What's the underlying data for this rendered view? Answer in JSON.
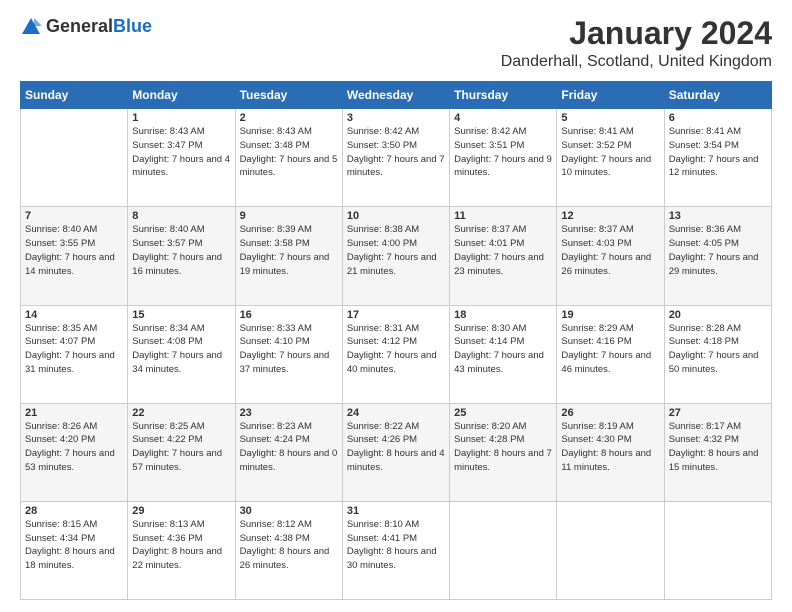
{
  "logo": {
    "general": "General",
    "blue": "Blue"
  },
  "header": {
    "month": "January 2024",
    "location": "Danderhall, Scotland, United Kingdom"
  },
  "days_of_week": [
    "Sunday",
    "Monday",
    "Tuesday",
    "Wednesday",
    "Thursday",
    "Friday",
    "Saturday"
  ],
  "weeks": [
    [
      {
        "day": "",
        "sunrise": "",
        "sunset": "",
        "daylight": ""
      },
      {
        "day": "1",
        "sunrise": "Sunrise: 8:43 AM",
        "sunset": "Sunset: 3:47 PM",
        "daylight": "Daylight: 7 hours and 4 minutes."
      },
      {
        "day": "2",
        "sunrise": "Sunrise: 8:43 AM",
        "sunset": "Sunset: 3:48 PM",
        "daylight": "Daylight: 7 hours and 5 minutes."
      },
      {
        "day": "3",
        "sunrise": "Sunrise: 8:42 AM",
        "sunset": "Sunset: 3:50 PM",
        "daylight": "Daylight: 7 hours and 7 minutes."
      },
      {
        "day": "4",
        "sunrise": "Sunrise: 8:42 AM",
        "sunset": "Sunset: 3:51 PM",
        "daylight": "Daylight: 7 hours and 9 minutes."
      },
      {
        "day": "5",
        "sunrise": "Sunrise: 8:41 AM",
        "sunset": "Sunset: 3:52 PM",
        "daylight": "Daylight: 7 hours and 10 minutes."
      },
      {
        "day": "6",
        "sunrise": "Sunrise: 8:41 AM",
        "sunset": "Sunset: 3:54 PM",
        "daylight": "Daylight: 7 hours and 12 minutes."
      }
    ],
    [
      {
        "day": "7",
        "sunrise": "Sunrise: 8:40 AM",
        "sunset": "Sunset: 3:55 PM",
        "daylight": "Daylight: 7 hours and 14 minutes."
      },
      {
        "day": "8",
        "sunrise": "Sunrise: 8:40 AM",
        "sunset": "Sunset: 3:57 PM",
        "daylight": "Daylight: 7 hours and 16 minutes."
      },
      {
        "day": "9",
        "sunrise": "Sunrise: 8:39 AM",
        "sunset": "Sunset: 3:58 PM",
        "daylight": "Daylight: 7 hours and 19 minutes."
      },
      {
        "day": "10",
        "sunrise": "Sunrise: 8:38 AM",
        "sunset": "Sunset: 4:00 PM",
        "daylight": "Daylight: 7 hours and 21 minutes."
      },
      {
        "day": "11",
        "sunrise": "Sunrise: 8:37 AM",
        "sunset": "Sunset: 4:01 PM",
        "daylight": "Daylight: 7 hours and 23 minutes."
      },
      {
        "day": "12",
        "sunrise": "Sunrise: 8:37 AM",
        "sunset": "Sunset: 4:03 PM",
        "daylight": "Daylight: 7 hours and 26 minutes."
      },
      {
        "day": "13",
        "sunrise": "Sunrise: 8:36 AM",
        "sunset": "Sunset: 4:05 PM",
        "daylight": "Daylight: 7 hours and 29 minutes."
      }
    ],
    [
      {
        "day": "14",
        "sunrise": "Sunrise: 8:35 AM",
        "sunset": "Sunset: 4:07 PM",
        "daylight": "Daylight: 7 hours and 31 minutes."
      },
      {
        "day": "15",
        "sunrise": "Sunrise: 8:34 AM",
        "sunset": "Sunset: 4:08 PM",
        "daylight": "Daylight: 7 hours and 34 minutes."
      },
      {
        "day": "16",
        "sunrise": "Sunrise: 8:33 AM",
        "sunset": "Sunset: 4:10 PM",
        "daylight": "Daylight: 7 hours and 37 minutes."
      },
      {
        "day": "17",
        "sunrise": "Sunrise: 8:31 AM",
        "sunset": "Sunset: 4:12 PM",
        "daylight": "Daylight: 7 hours and 40 minutes."
      },
      {
        "day": "18",
        "sunrise": "Sunrise: 8:30 AM",
        "sunset": "Sunset: 4:14 PM",
        "daylight": "Daylight: 7 hours and 43 minutes."
      },
      {
        "day": "19",
        "sunrise": "Sunrise: 8:29 AM",
        "sunset": "Sunset: 4:16 PM",
        "daylight": "Daylight: 7 hours and 46 minutes."
      },
      {
        "day": "20",
        "sunrise": "Sunrise: 8:28 AM",
        "sunset": "Sunset: 4:18 PM",
        "daylight": "Daylight: 7 hours and 50 minutes."
      }
    ],
    [
      {
        "day": "21",
        "sunrise": "Sunrise: 8:26 AM",
        "sunset": "Sunset: 4:20 PM",
        "daylight": "Daylight: 7 hours and 53 minutes."
      },
      {
        "day": "22",
        "sunrise": "Sunrise: 8:25 AM",
        "sunset": "Sunset: 4:22 PM",
        "daylight": "Daylight: 7 hours and 57 minutes."
      },
      {
        "day": "23",
        "sunrise": "Sunrise: 8:23 AM",
        "sunset": "Sunset: 4:24 PM",
        "daylight": "Daylight: 8 hours and 0 minutes."
      },
      {
        "day": "24",
        "sunrise": "Sunrise: 8:22 AM",
        "sunset": "Sunset: 4:26 PM",
        "daylight": "Daylight: 8 hours and 4 minutes."
      },
      {
        "day": "25",
        "sunrise": "Sunrise: 8:20 AM",
        "sunset": "Sunset: 4:28 PM",
        "daylight": "Daylight: 8 hours and 7 minutes."
      },
      {
        "day": "26",
        "sunrise": "Sunrise: 8:19 AM",
        "sunset": "Sunset: 4:30 PM",
        "daylight": "Daylight: 8 hours and 11 minutes."
      },
      {
        "day": "27",
        "sunrise": "Sunrise: 8:17 AM",
        "sunset": "Sunset: 4:32 PM",
        "daylight": "Daylight: 8 hours and 15 minutes."
      }
    ],
    [
      {
        "day": "28",
        "sunrise": "Sunrise: 8:15 AM",
        "sunset": "Sunset: 4:34 PM",
        "daylight": "Daylight: 8 hours and 18 minutes."
      },
      {
        "day": "29",
        "sunrise": "Sunrise: 8:13 AM",
        "sunset": "Sunset: 4:36 PM",
        "daylight": "Daylight: 8 hours and 22 minutes."
      },
      {
        "day": "30",
        "sunrise": "Sunrise: 8:12 AM",
        "sunset": "Sunset: 4:38 PM",
        "daylight": "Daylight: 8 hours and 26 minutes."
      },
      {
        "day": "31",
        "sunrise": "Sunrise: 8:10 AM",
        "sunset": "Sunset: 4:41 PM",
        "daylight": "Daylight: 8 hours and 30 minutes."
      },
      {
        "day": "",
        "sunrise": "",
        "sunset": "",
        "daylight": ""
      },
      {
        "day": "",
        "sunrise": "",
        "sunset": "",
        "daylight": ""
      },
      {
        "day": "",
        "sunrise": "",
        "sunset": "",
        "daylight": ""
      }
    ]
  ]
}
